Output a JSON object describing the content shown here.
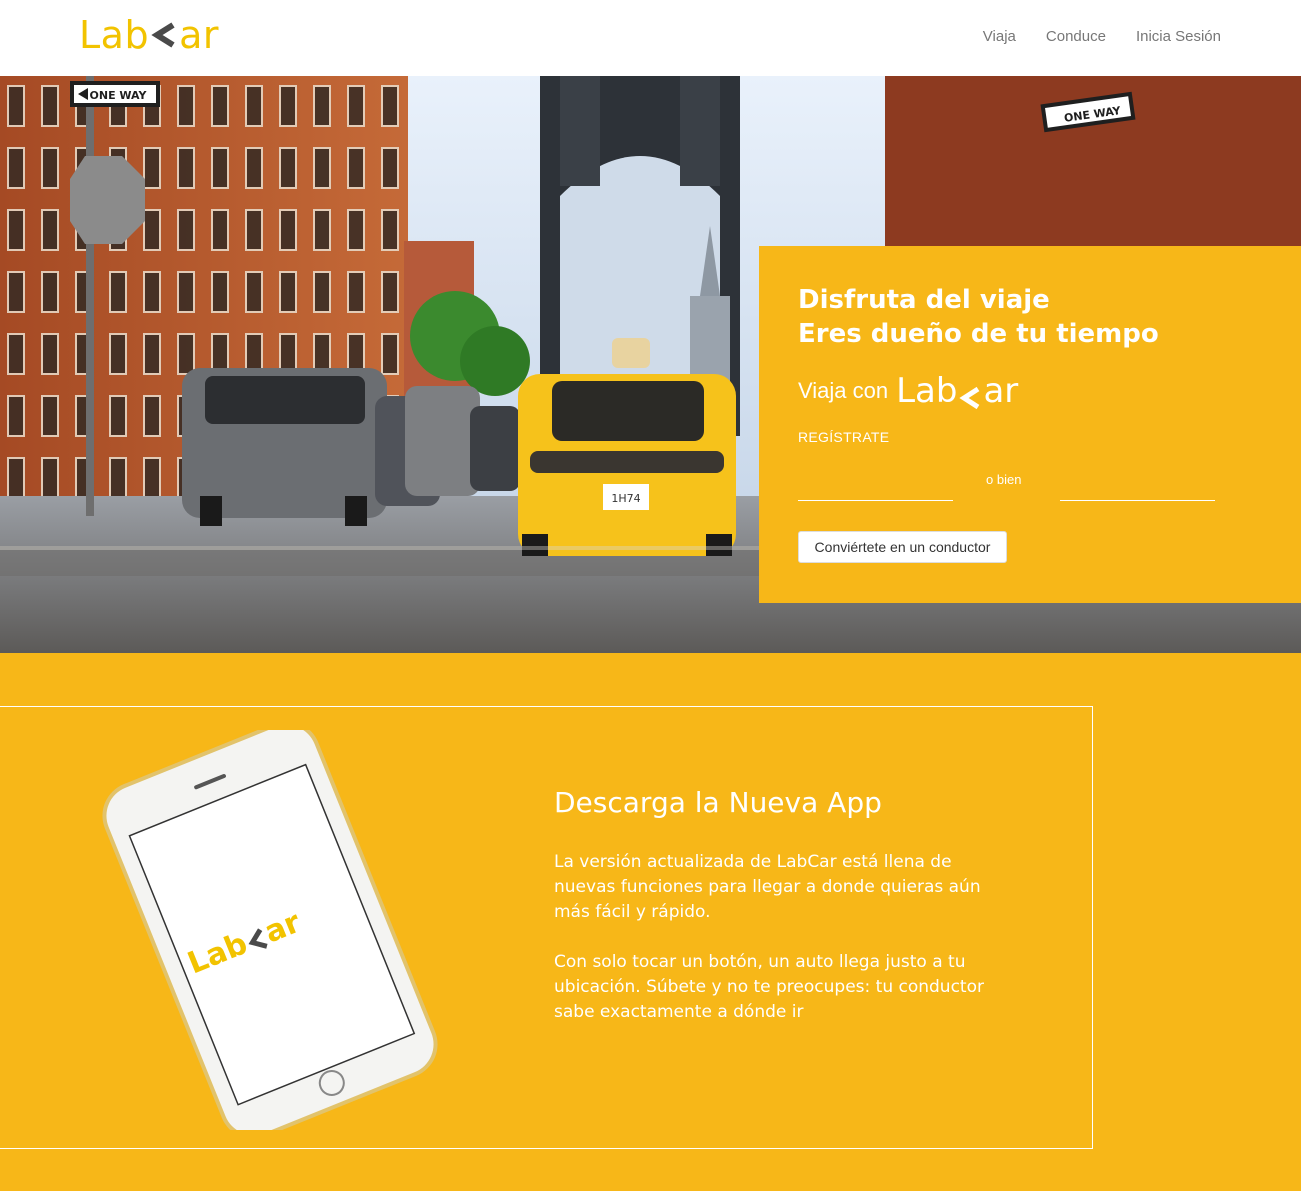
{
  "header": {
    "logo_left": "Lab",
    "logo_right": "ar",
    "nav": [
      "Viaja",
      "Conduce",
      "Inicia Sesión"
    ]
  },
  "hero": {
    "headline_line1": "Disfruta del viaje",
    "headline_line2": "Eres dueño de tu tiempo",
    "viaja_con": "Viaja con",
    "register": "REGÍSTRATE",
    "or": "o bien",
    "driver_button": "Conviértete en un conductor",
    "street_signs": [
      "ONE WAY",
      "ONE WAY"
    ],
    "taxi_plate": "1H74"
  },
  "app": {
    "title": "Descarga la Nueva App",
    "paragraph1": "La versión actualizada de LabCar está llena de nuevas funciones para llegar a donde quieras aún más fácil y rápido.",
    "paragraph2": "Con solo tocar un botón, un auto llega justo a tu ubicación. Súbete y no te preocupes: tu conductor sabe exactamente a dónde ir"
  },
  "colors": {
    "brand_yellow": "#f7b718",
    "logo_yellow": "#f2c300",
    "logo_chevron": "#4a4a4a",
    "nav_text": "#777777",
    "white": "#ffffff"
  },
  "icons": {
    "logo_chevron": "chevron-left-icon"
  }
}
